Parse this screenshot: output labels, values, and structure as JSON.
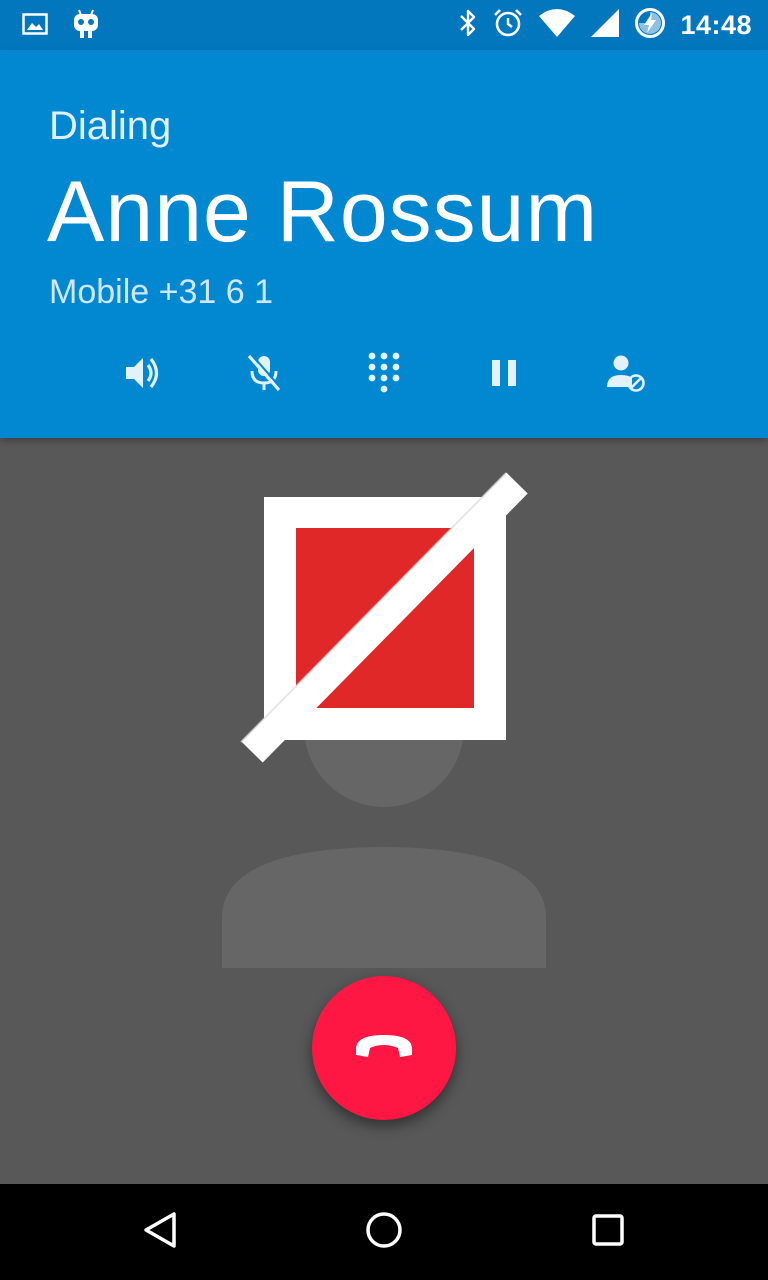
{
  "status_bar": {
    "time": "14:48",
    "left_icons": [
      "image-icon",
      "android-robot-icon"
    ],
    "right_icons": [
      "bluetooth-icon",
      "alarm-icon",
      "wifi-icon",
      "cell-signal-icon",
      "battery-charging-icon"
    ]
  },
  "call": {
    "state": "Dialing",
    "name": "Anne Rossum",
    "number": "Mobile +31 6 1"
  },
  "call_buttons": [
    "speaker-icon",
    "mute-mic-icon",
    "dialpad-icon",
    "pause-icon",
    "block-contact-icon"
  ],
  "colors": {
    "header": "#0288D1",
    "status_bar": "#0277BD",
    "body": "#585858",
    "end_call": "#FF1744",
    "broken_image_red": "#E02828"
  },
  "navigation": [
    "back-icon",
    "home-icon",
    "recents-icon"
  ]
}
